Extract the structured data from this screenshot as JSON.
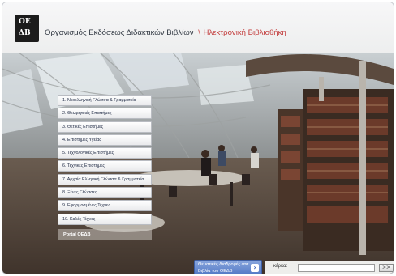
{
  "header": {
    "logo_top": "ΟΕ",
    "logo_bottom": "ΔΒ",
    "org_name": "Οργανισμός Εκδόσεως Διδακτικών Βιβλίων",
    "separator": "\\",
    "section": "Ηλεκτρονική Βιβλιοθήκη"
  },
  "menu": {
    "items": [
      "1. Νεοελληνική Γλώσσα & Γραμματεία",
      "2. Θεωρητικές Επιστήμες",
      "3. Θετικές Επιστήμες",
      "4. Επιστήμες Υγείας",
      "5. Τεχνολογικές Επιστήμες",
      "6. Τεχνικές Επιστήμες",
      "7. Αρχαία Ελληνική Γλώσσα & Γραμματεία",
      "8. Ξένες Γλώσσες",
      "9. Εφαρμοσμένες Τέχνες",
      "10. Καλές Τέχνες"
    ],
    "portal": "Portal ΟΕΔΒ"
  },
  "info": {
    "text": "Θεματικές Διαδρομές στα Βιβλία του ΟΕΔΒ",
    "icon": "info-arrow-icon"
  },
  "search": {
    "label": "κέρκα:",
    "value": "",
    "button": ">>"
  },
  "colors": {
    "title_text": "#333a44",
    "accent_red": "#c23a3a",
    "info_blue": "#4f76c4"
  }
}
